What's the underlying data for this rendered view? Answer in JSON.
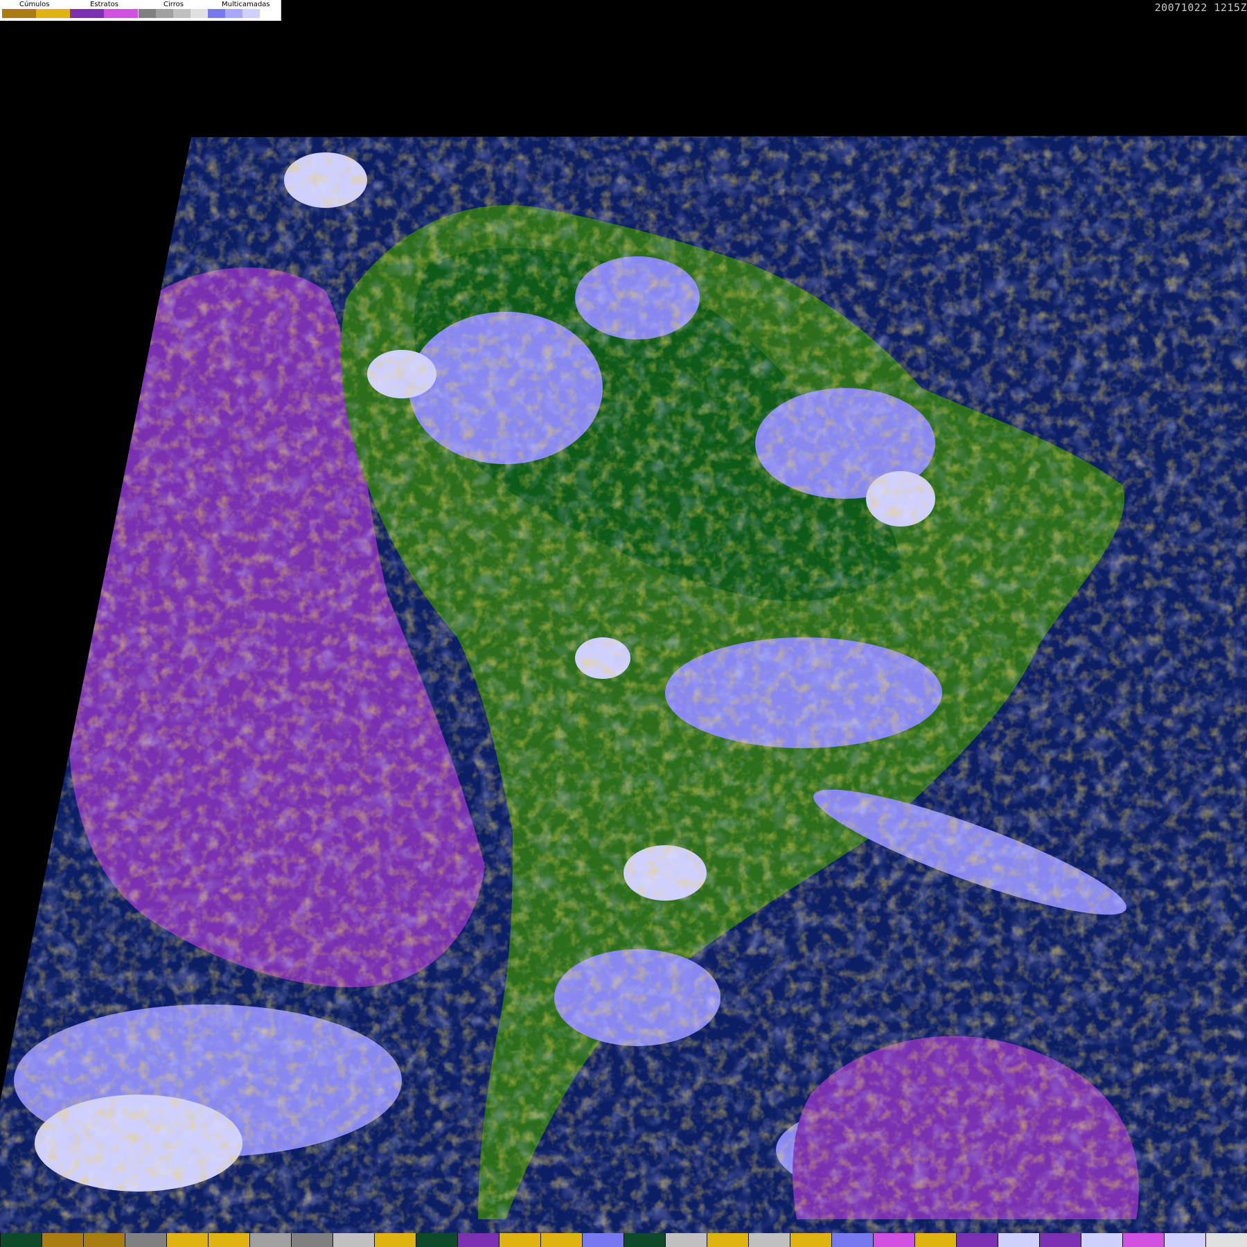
{
  "timestamp": "20071022 1215Z",
  "legend": {
    "groups": [
      {
        "label": "Cúmulos",
        "colors": [
          "#a87c10",
          "#e0b410"
        ]
      },
      {
        "label": "Estratos",
        "colors": [
          "#7a30b0",
          "#d050e0"
        ]
      },
      {
        "label": "Cirros",
        "colors": [
          "#808080",
          "#a0a0a0",
          "#c0c0c0",
          "#e0e0e0"
        ]
      },
      {
        "label": "Multicamadas",
        "colors": [
          "#7878f0",
          "#a8a8f8",
          "#d0d0ff",
          "#ffffff"
        ]
      }
    ]
  },
  "palette": {
    "ocean": "#0c1e64",
    "stratus": "#7a30b0",
    "cumulus": "#d8a818",
    "land": "#2c6e1c",
    "forest": "#0e5a18",
    "multilayer": "#8888f0",
    "cirrus": "#c0c0c8"
  },
  "bottom_bar": [
    "#0e4a2a",
    "#a87c10",
    "#a87c10",
    "#808080",
    "#e0b410",
    "#e0b410",
    "#a0a0a0",
    "#808080",
    "#c0c0c0",
    "#e0b410",
    "#0e4a2a",
    "#7a30b0",
    "#e0b410",
    "#e0b410",
    "#7878f0",
    "#0e4a2a",
    "#c0c0c0",
    "#e0b410",
    "#c0c0c0",
    "#e0b410",
    "#7878f0",
    "#d050e0",
    "#e0b410",
    "#7a30b0",
    "#d0d0ff",
    "#7a30b0",
    "#d0d0ff",
    "#d050e0",
    "#d0d0ff",
    "#e0e0e0"
  ]
}
